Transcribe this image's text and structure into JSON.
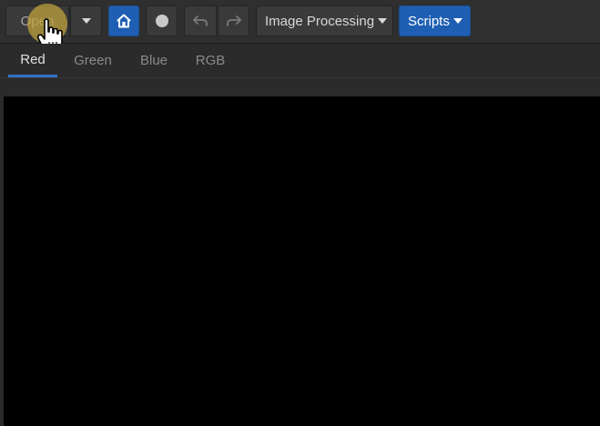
{
  "toolbar": {
    "open_label": "Open",
    "open_dropdown_icon": "chevron-down-icon",
    "home_icon": "home-icon",
    "record_icon": "record-icon",
    "undo_icon": "undo-icon",
    "redo_icon": "redo-icon",
    "image_processing_label": "Image Processing",
    "scripts_label": "Scripts"
  },
  "tabs": [
    {
      "label": "Red",
      "active": true
    },
    {
      "label": "Green",
      "active": false
    },
    {
      "label": "Blue",
      "active": false
    },
    {
      "label": "RGB",
      "active": false
    }
  ],
  "colors": {
    "accent": "#1f5fb3",
    "tab_underline": "#2f74c8",
    "background": "#2b2b2b",
    "canvas": "#000000"
  }
}
